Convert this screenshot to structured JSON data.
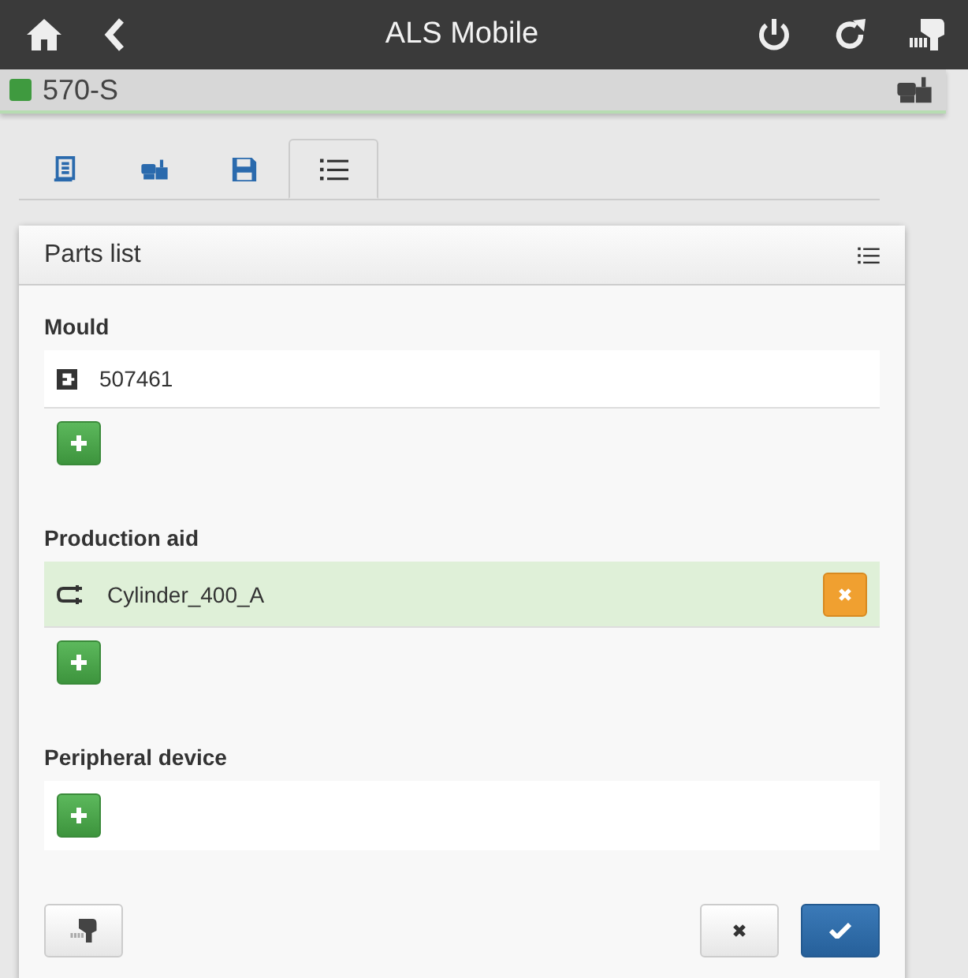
{
  "header": {
    "title": "ALS Mobile"
  },
  "machine": {
    "name": "570-S",
    "color": "#3f9a3f"
  },
  "tabs": [
    {
      "kind": "document",
      "selected": false
    },
    {
      "kind": "machine",
      "selected": false
    },
    {
      "kind": "save",
      "selected": false
    },
    {
      "kind": "list",
      "selected": true
    }
  ],
  "panel": {
    "title": "Parts list",
    "sections": [
      {
        "title": "Mould",
        "items": [
          {
            "kind": "mould",
            "label": "507461",
            "highlighted": false,
            "removable": false
          }
        ]
      },
      {
        "title": "Production aid",
        "items": [
          {
            "kind": "cylinder",
            "label": "Cylinder_400_A",
            "highlighted": true,
            "removable": true
          }
        ]
      },
      {
        "title": "Peripheral device"
      }
    ]
  }
}
